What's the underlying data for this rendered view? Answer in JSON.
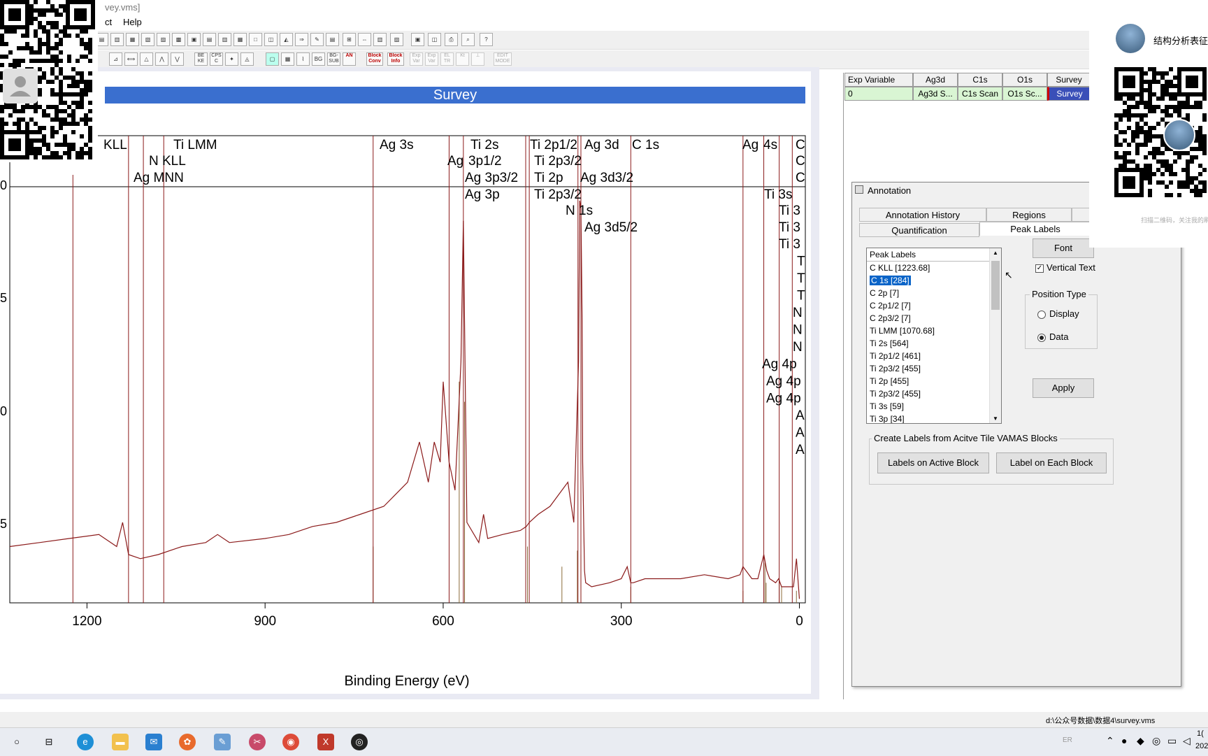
{
  "window": {
    "title_fragment": "vey.vms]"
  },
  "menu": {
    "items": [
      "ct",
      "Help"
    ]
  },
  "toolbar": {
    "row2_labels": [
      "BE KE",
      "CPS C",
      "BG",
      "BG- SUB",
      "Block Conv",
      "Block Info",
      "Exp Var",
      "Exp Var",
      "EL TR",
      "Kt",
      "EDIT MODE"
    ]
  },
  "plot": {
    "title": "Survey",
    "xlabel": "Binding Energy (eV)",
    "y_tick_fragments": [
      "0",
      "5",
      "0",
      "5"
    ]
  },
  "peak_labels_row1": [
    "KLL",
    "Ti LMM",
    "Ag 3s",
    "Ti 2s",
    "Ti 2p1/2",
    "Ag 3d",
    "C 1s",
    "Ag",
    "4s",
    "C"
  ],
  "peak_labels_row2": [
    "N KLL",
    "Ag",
    "3p1/2",
    "Ti 2p3/2",
    "C"
  ],
  "peak_labels_row3": [
    "Ag MNN",
    "Ag 3p3/2",
    "Ti 2p",
    "Ag 3d3/2",
    "C"
  ],
  "peak_labels_row4": [
    "Ag 3p",
    "Ti 2p3/2",
    "Ti 3s"
  ],
  "peak_labels_row5": [
    "N 1s",
    "Ti 3"
  ],
  "peak_labels_row6": [
    "Ag 3d5/2",
    "Ti 3"
  ],
  "peak_labels_stack": [
    "Ti 3",
    "T",
    "T",
    "T",
    "N",
    "N",
    "N",
    "Ag 4p",
    "Ag 4p",
    "Ag 4p",
    "A",
    "A",
    "A"
  ],
  "chart_data": {
    "type": "line",
    "title": "Survey",
    "xlabel": "Binding Energy (eV)",
    "ylabel": "",
    "x_ticks": [
      1200,
      900,
      600,
      300,
      0
    ],
    "xlim": [
      1330,
      -10
    ],
    "series": [
      {
        "x": [
          1330,
          1280,
          1230,
          1180,
          1150,
          1140,
          1130,
          1110,
          1080,
          1040,
          1000,
          980,
          960,
          900,
          860,
          820,
          780,
          740,
          700,
          680,
          660,
          640,
          625,
          615,
          605,
          600,
          590,
          580,
          570,
          566,
          560,
          540,
          532,
          525,
          500,
          470,
          460,
          455,
          440,
          420,
          400,
          390,
          380,
          372,
          370,
          368,
          366,
          365,
          362,
          360,
          350,
          320,
          300,
          290,
          284,
          280,
          260,
          230,
          200,
          160,
          120,
          100,
          95,
          80,
          70,
          60,
          55,
          50,
          40,
          35,
          30,
          10,
          5,
          0
        ],
        "y": [
          0.14,
          0.15,
          0.16,
          0.17,
          0.14,
          0.2,
          0.12,
          0.11,
          0.12,
          0.14,
          0.15,
          0.17,
          0.15,
          0.16,
          0.17,
          0.19,
          0.2,
          0.22,
          0.24,
          0.27,
          0.3,
          0.4,
          0.3,
          0.4,
          0.35,
          0.55,
          0.35,
          0.28,
          0.6,
          0.95,
          0.2,
          0.15,
          0.22,
          0.16,
          0.17,
          0.18,
          0.19,
          0.2,
          0.22,
          0.24,
          0.28,
          0.3,
          0.2,
          0.6,
          1.0,
          0.98,
          0.7,
          0.35,
          0.08,
          0.05,
          0.04,
          0.05,
          0.06,
          0.09,
          0.05,
          0.05,
          0.06,
          0.06,
          0.06,
          0.07,
          0.06,
          0.07,
          0.09,
          0.06,
          0.06,
          0.12,
          0.08,
          0.06,
          0.05,
          0.06,
          0.04,
          0.04,
          0.11,
          0.01
        ]
      }
    ]
  },
  "exp_table": {
    "headers": [
      "Exp Variable",
      "Ag3d",
      "C1s",
      "O1s",
      "Survey"
    ],
    "row": [
      "0",
      "Ag3d S...",
      "C1s Scan",
      "O1s Sc...",
      "Survey"
    ]
  },
  "annotation": {
    "title": "Annotation",
    "tabs": [
      "Annotation History",
      "Regions",
      "Quantification",
      "Peak Labels"
    ],
    "list_header": "Peak Labels",
    "list_items": [
      "C KLL [1223.68]",
      "C 1s [284]",
      "C 2p [7]",
      "C 2p1/2 [7]",
      "C 2p3/2 [7]",
      "Ti LMM [1070.68]",
      "Ti 2s [564]",
      "Ti 2p1/2 [461]",
      "Ti 2p3/2 [455]",
      "Ti 2p [455]",
      "Ti 2p3/2 [455]",
      "Ti 3s [59]",
      "Ti 3p [34]"
    ],
    "selected_index": 1,
    "font_button": "Font",
    "vertical_text_label": "Vertical Text",
    "vertical_text_checked": true,
    "position_type_label": "Position Type",
    "position_options": [
      "Display",
      "Data"
    ],
    "position_selected": "Data",
    "apply_button": "Apply",
    "create_group_label": "Create Labels from Acitve Tile VAMAS Blocks",
    "labels_active_button": "Labels on Active Block",
    "label_each_button": "Label on Each Block"
  },
  "overlay": {
    "account_name": "结构分析表征",
    "caption": "扫描二维码，关注我的刷"
  },
  "status": {
    "path": "d:\\公众号数据\\数据4\\survey.vms"
  },
  "taskbar": {
    "tray_lang": "ER",
    "clock_fragment_1": "1(",
    "clock_fragment_2": "202"
  },
  "colors": {
    "title_bar": "#3a6fcf",
    "spectrum": "#8b1a1a",
    "marker": "#8b1a1a",
    "marker_tan": "#8b6b3a",
    "selection": "#0a64c8",
    "exp_row": "#d9f5d3"
  }
}
